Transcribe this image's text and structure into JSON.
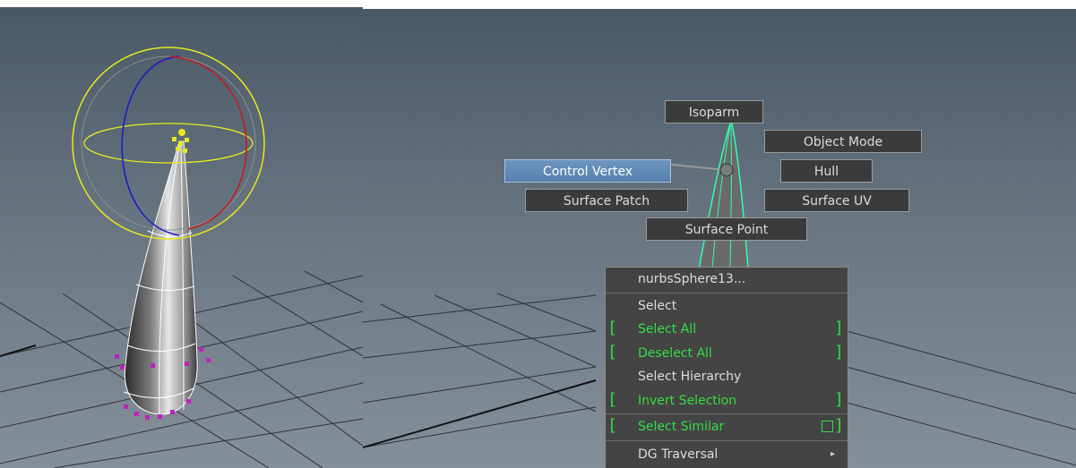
{
  "marking_menu": {
    "items": {
      "isoparm": "Isoparm",
      "object_mode": "Object Mode",
      "control_vertex": "Control Vertex",
      "hull": "Hull",
      "surface_patch": "Surface Patch",
      "surface_uv": "Surface UV",
      "surface_point": "Surface Point"
    },
    "highlighted": "Control Vertex"
  },
  "context_menu": {
    "header": "nurbsSphere13...",
    "items": [
      {
        "label": "Select",
        "has_option_bracket": false
      },
      {
        "label": "Select All",
        "has_option_bracket": true
      },
      {
        "label": "Deselect All",
        "has_option_bracket": true
      },
      {
        "label": "Select Hierarchy",
        "has_option_bracket": false
      },
      {
        "label": "Invert Selection",
        "has_option_bracket": true
      },
      {
        "label": "Select Similar",
        "has_option_bracket": true,
        "has_option_box": true
      },
      {
        "label": "DG Traversal",
        "has_submenu": true
      }
    ]
  },
  "colors": {
    "highlight": "#6d95bf",
    "green_text": "#33dd44",
    "menu_bg": "#444444",
    "manipulator_yellow": "#e8e820"
  }
}
